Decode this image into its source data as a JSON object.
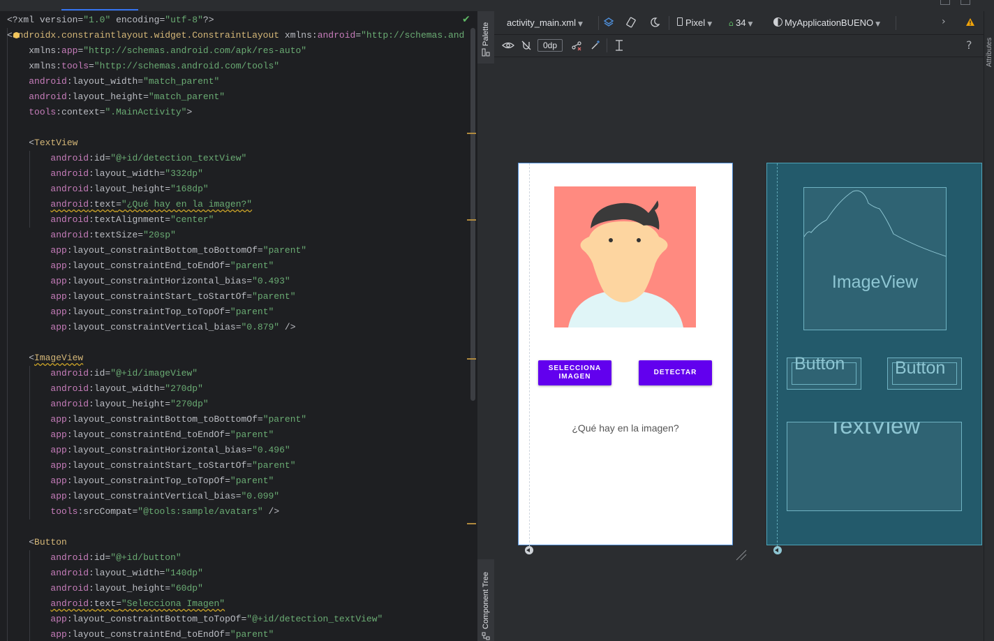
{
  "editor": {
    "lines": [
      [
        [
          "p",
          "<?xml "
        ],
        [
          "attr",
          "version"
        ],
        [
          "p",
          "="
        ],
        [
          "val",
          "\"1.0\""
        ],
        [
          "p",
          " "
        ],
        [
          "attr",
          "encoding"
        ],
        [
          "p",
          "="
        ],
        [
          "val",
          "\"utf-8\""
        ],
        [
          "p",
          "?>"
        ]
      ],
      [
        [
          "p",
          "<"
        ],
        [
          "tag",
          "androidx.constraintlayout.widget.ConstraintLayout"
        ],
        [
          "p",
          " "
        ],
        [
          "attr",
          "xmlns:"
        ],
        [
          "ns",
          "android"
        ],
        [
          "p",
          "="
        ],
        [
          "val",
          "\"http://schemas.and"
        ]
      ],
      [
        [
          "p",
          "    "
        ],
        [
          "attr",
          "xmlns:"
        ],
        [
          "ns",
          "app"
        ],
        [
          "p",
          "="
        ],
        [
          "val",
          "\"http://schemas.android.com/apk/res-auto\""
        ]
      ],
      [
        [
          "p",
          "    "
        ],
        [
          "attr",
          "xmlns:"
        ],
        [
          "ns",
          "tools"
        ],
        [
          "p",
          "="
        ],
        [
          "val",
          "\"http://schemas.android.com/tools\""
        ]
      ],
      [
        [
          "p",
          "    "
        ],
        [
          "ns",
          "android"
        ],
        [
          "p",
          ":"
        ],
        [
          "attr",
          "layout_width"
        ],
        [
          "p",
          "="
        ],
        [
          "val",
          "\"match_parent\""
        ]
      ],
      [
        [
          "p",
          "    "
        ],
        [
          "ns",
          "android"
        ],
        [
          "p",
          ":"
        ],
        [
          "attr",
          "layout_height"
        ],
        [
          "p",
          "="
        ],
        [
          "val",
          "\"match_parent\""
        ]
      ],
      [
        [
          "p",
          "    "
        ],
        [
          "ns",
          "tools"
        ],
        [
          "p",
          ":"
        ],
        [
          "attr",
          "context"
        ],
        [
          "p",
          "="
        ],
        [
          "val",
          "\".MainActivity\""
        ],
        [
          "p",
          ">"
        ]
      ],
      [],
      [
        [
          "p",
          "    <"
        ],
        [
          "tag",
          "TextView"
        ]
      ],
      [
        [
          "p",
          "        "
        ],
        [
          "ns",
          "android"
        ],
        [
          "p",
          ":"
        ],
        [
          "attr",
          "id"
        ],
        [
          "p",
          "="
        ],
        [
          "val",
          "\"@+id/detection_textView\""
        ]
      ],
      [
        [
          "p",
          "        "
        ],
        [
          "ns",
          "android"
        ],
        [
          "p",
          ":"
        ],
        [
          "attr",
          "layout_width"
        ],
        [
          "p",
          "="
        ],
        [
          "val",
          "\"332dp\""
        ]
      ],
      [
        [
          "p",
          "        "
        ],
        [
          "ns",
          "android"
        ],
        [
          "p",
          ":"
        ],
        [
          "attr",
          "layout_height"
        ],
        [
          "p",
          "="
        ],
        [
          "val",
          "\"168dp\""
        ]
      ],
      [
        [
          "p",
          "        "
        ],
        [
          "nsw",
          "android"
        ],
        [
          "pw",
          ":"
        ],
        [
          "attrw",
          "text"
        ],
        [
          "pw",
          "="
        ],
        [
          "valw",
          "\"¿Qué hay en la imagen?\""
        ]
      ],
      [
        [
          "p",
          "        "
        ],
        [
          "ns",
          "android"
        ],
        [
          "p",
          ":"
        ],
        [
          "attr",
          "textAlignment"
        ],
        [
          "p",
          "="
        ],
        [
          "val",
          "\"center\""
        ]
      ],
      [
        [
          "p",
          "        "
        ],
        [
          "ns",
          "android"
        ],
        [
          "p",
          ":"
        ],
        [
          "attr",
          "textSize"
        ],
        [
          "p",
          "="
        ],
        [
          "val",
          "\"20sp\""
        ]
      ],
      [
        [
          "p",
          "        "
        ],
        [
          "ns",
          "app"
        ],
        [
          "p",
          ":"
        ],
        [
          "attr",
          "layout_constraintBottom_toBottomOf"
        ],
        [
          "p",
          "="
        ],
        [
          "val",
          "\"parent\""
        ]
      ],
      [
        [
          "p",
          "        "
        ],
        [
          "ns",
          "app"
        ],
        [
          "p",
          ":"
        ],
        [
          "attr",
          "layout_constraintEnd_toEndOf"
        ],
        [
          "p",
          "="
        ],
        [
          "val",
          "\"parent\""
        ]
      ],
      [
        [
          "p",
          "        "
        ],
        [
          "ns",
          "app"
        ],
        [
          "p",
          ":"
        ],
        [
          "attr",
          "layout_constraintHorizontal_bias"
        ],
        [
          "p",
          "="
        ],
        [
          "val",
          "\"0.493\""
        ]
      ],
      [
        [
          "p",
          "        "
        ],
        [
          "ns",
          "app"
        ],
        [
          "p",
          ":"
        ],
        [
          "attr",
          "layout_constraintStart_toStartOf"
        ],
        [
          "p",
          "="
        ],
        [
          "val",
          "\"parent\""
        ]
      ],
      [
        [
          "p",
          "        "
        ],
        [
          "ns",
          "app"
        ],
        [
          "p",
          ":"
        ],
        [
          "attr",
          "layout_constraintTop_toTopOf"
        ],
        [
          "p",
          "="
        ],
        [
          "val",
          "\"parent\""
        ]
      ],
      [
        [
          "p",
          "        "
        ],
        [
          "ns",
          "app"
        ],
        [
          "p",
          ":"
        ],
        [
          "attr",
          "layout_constraintVertical_bias"
        ],
        [
          "p",
          "="
        ],
        [
          "val",
          "\"0.879\""
        ],
        [
          "p",
          " />"
        ]
      ],
      [],
      [
        [
          "p",
          "    <"
        ],
        [
          "tagw",
          "ImageView"
        ]
      ],
      [
        [
          "p",
          "        "
        ],
        [
          "ns",
          "android"
        ],
        [
          "p",
          ":"
        ],
        [
          "attr",
          "id"
        ],
        [
          "p",
          "="
        ],
        [
          "val",
          "\"@+id/imageView\""
        ]
      ],
      [
        [
          "p",
          "        "
        ],
        [
          "ns",
          "android"
        ],
        [
          "p",
          ":"
        ],
        [
          "attr",
          "layout_width"
        ],
        [
          "p",
          "="
        ],
        [
          "val",
          "\"270dp\""
        ]
      ],
      [
        [
          "p",
          "        "
        ],
        [
          "ns",
          "android"
        ],
        [
          "p",
          ":"
        ],
        [
          "attr",
          "layout_height"
        ],
        [
          "p",
          "="
        ],
        [
          "val",
          "\"270dp\""
        ]
      ],
      [
        [
          "p",
          "        "
        ],
        [
          "ns",
          "app"
        ],
        [
          "p",
          ":"
        ],
        [
          "attr",
          "layout_constraintBottom_toBottomOf"
        ],
        [
          "p",
          "="
        ],
        [
          "val",
          "\"parent\""
        ]
      ],
      [
        [
          "p",
          "        "
        ],
        [
          "ns",
          "app"
        ],
        [
          "p",
          ":"
        ],
        [
          "attr",
          "layout_constraintEnd_toEndOf"
        ],
        [
          "p",
          "="
        ],
        [
          "val",
          "\"parent\""
        ]
      ],
      [
        [
          "p",
          "        "
        ],
        [
          "ns",
          "app"
        ],
        [
          "p",
          ":"
        ],
        [
          "attr",
          "layout_constraintHorizontal_bias"
        ],
        [
          "p",
          "="
        ],
        [
          "val",
          "\"0.496\""
        ]
      ],
      [
        [
          "p",
          "        "
        ],
        [
          "ns",
          "app"
        ],
        [
          "p",
          ":"
        ],
        [
          "attr",
          "layout_constraintStart_toStartOf"
        ],
        [
          "p",
          "="
        ],
        [
          "val",
          "\"parent\""
        ]
      ],
      [
        [
          "p",
          "        "
        ],
        [
          "ns",
          "app"
        ],
        [
          "p",
          ":"
        ],
        [
          "attr",
          "layout_constraintTop_toTopOf"
        ],
        [
          "p",
          "="
        ],
        [
          "val",
          "\"parent\""
        ]
      ],
      [
        [
          "p",
          "        "
        ],
        [
          "ns",
          "app"
        ],
        [
          "p",
          ":"
        ],
        [
          "attr",
          "layout_constraintVertical_bias"
        ],
        [
          "p",
          "="
        ],
        [
          "val",
          "\"0.099\""
        ]
      ],
      [
        [
          "p",
          "        "
        ],
        [
          "ns",
          "tools"
        ],
        [
          "p",
          ":"
        ],
        [
          "attr",
          "srcCompat"
        ],
        [
          "p",
          "="
        ],
        [
          "val",
          "\"@tools:sample/avatars\""
        ],
        [
          "p",
          " />"
        ]
      ],
      [],
      [
        [
          "p",
          "    <"
        ],
        [
          "tag",
          "Button"
        ]
      ],
      [
        [
          "p",
          "        "
        ],
        [
          "ns",
          "android"
        ],
        [
          "p",
          ":"
        ],
        [
          "attr",
          "id"
        ],
        [
          "p",
          "="
        ],
        [
          "val",
          "\"@+id/button\""
        ]
      ],
      [
        [
          "p",
          "        "
        ],
        [
          "ns",
          "android"
        ],
        [
          "p",
          ":"
        ],
        [
          "attr",
          "layout_width"
        ],
        [
          "p",
          "="
        ],
        [
          "val",
          "\"140dp\""
        ]
      ],
      [
        [
          "p",
          "        "
        ],
        [
          "ns",
          "android"
        ],
        [
          "p",
          ":"
        ],
        [
          "attr",
          "layout_height"
        ],
        [
          "p",
          "="
        ],
        [
          "val",
          "\"60dp\""
        ]
      ],
      [
        [
          "p",
          "        "
        ],
        [
          "nsw",
          "android"
        ],
        [
          "pw",
          ":"
        ],
        [
          "attrw",
          "text"
        ],
        [
          "pw",
          "="
        ],
        [
          "valw",
          "\"Selecciona Imagen\""
        ]
      ],
      [
        [
          "p",
          "        "
        ],
        [
          "ns",
          "app"
        ],
        [
          "p",
          ":"
        ],
        [
          "attr",
          "layout_constraintBottom_toTopOf"
        ],
        [
          "p",
          "="
        ],
        [
          "val",
          "\"@+id/detection_textView\""
        ]
      ],
      [
        [
          "p",
          "        "
        ],
        [
          "ns",
          "app"
        ],
        [
          "p",
          ":"
        ],
        [
          "attr",
          "layout_constraintEnd_toEndOf"
        ],
        [
          "p",
          "="
        ],
        [
          "val",
          "\"parent\""
        ]
      ]
    ]
  },
  "side_tabs": {
    "palette": "Palette",
    "component_tree": "Component Tree",
    "attributes": "Attributes"
  },
  "toolbar": {
    "file": "activity_main.xml",
    "device": "Pixel",
    "api": "34",
    "theme": "MyApplicationBUENO",
    "margin": "0dp",
    "help": "?"
  },
  "preview": {
    "button1": "SELECCIONA IMAGEN",
    "button2": "DETECTAR",
    "text": "¿Qué hay en la imagen?"
  },
  "blueprint": {
    "imageview": "ImageView",
    "button1": "Button",
    "button2": "Button",
    "textview": "TextView"
  },
  "colors": {
    "button": "#6200ee",
    "avatar_bg": "#ff8a80",
    "blueprint_bg": "#235a6b",
    "warning": "#f0a30a"
  }
}
